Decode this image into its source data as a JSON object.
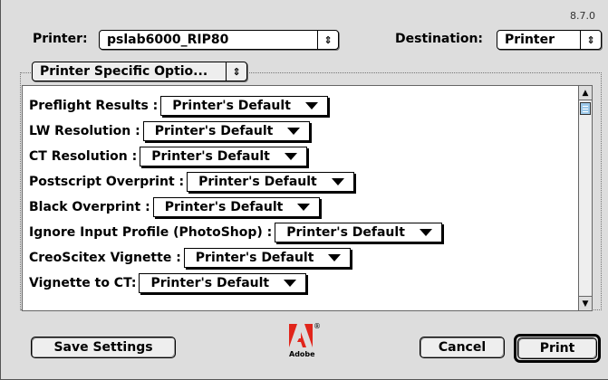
{
  "dialog": {
    "version": "8.7.0",
    "printer_label": "Printer:",
    "printer_value": "pslab6000_RIP80",
    "destination_label": "Destination:",
    "destination_value": "Printer",
    "section_popup": "Printer Specific Optio...",
    "logo_text": "Adobe",
    "logo_mark": "®"
  },
  "options": [
    {
      "label": "Preflight Results :",
      "value": "Printer's Default"
    },
    {
      "label": "LW Resolution :",
      "value": "Printer's Default"
    },
    {
      "label": "CT Resolution :",
      "value": "Printer's Default"
    },
    {
      "label": "Postscript Overprint :",
      "value": "Printer's Default"
    },
    {
      "label": "Black Overprint :",
      "value": "Printer's Default"
    },
    {
      "label": "Ignore Input Profile (PhotoShop) :",
      "value": "Printer's Default"
    },
    {
      "label": "CreoScitex Vignette :",
      "value": "Printer's Default"
    },
    {
      "label": "Vignette to CT:",
      "value": "Printer's Default"
    }
  ],
  "buttons": {
    "save_settings": "Save Settings",
    "cancel": "Cancel",
    "print": "Print"
  },
  "icons": {
    "popup_arrow": "⇕",
    "scroll_up": "▲",
    "scroll_down": "▼",
    "logo": "adobe-logo-icon"
  }
}
